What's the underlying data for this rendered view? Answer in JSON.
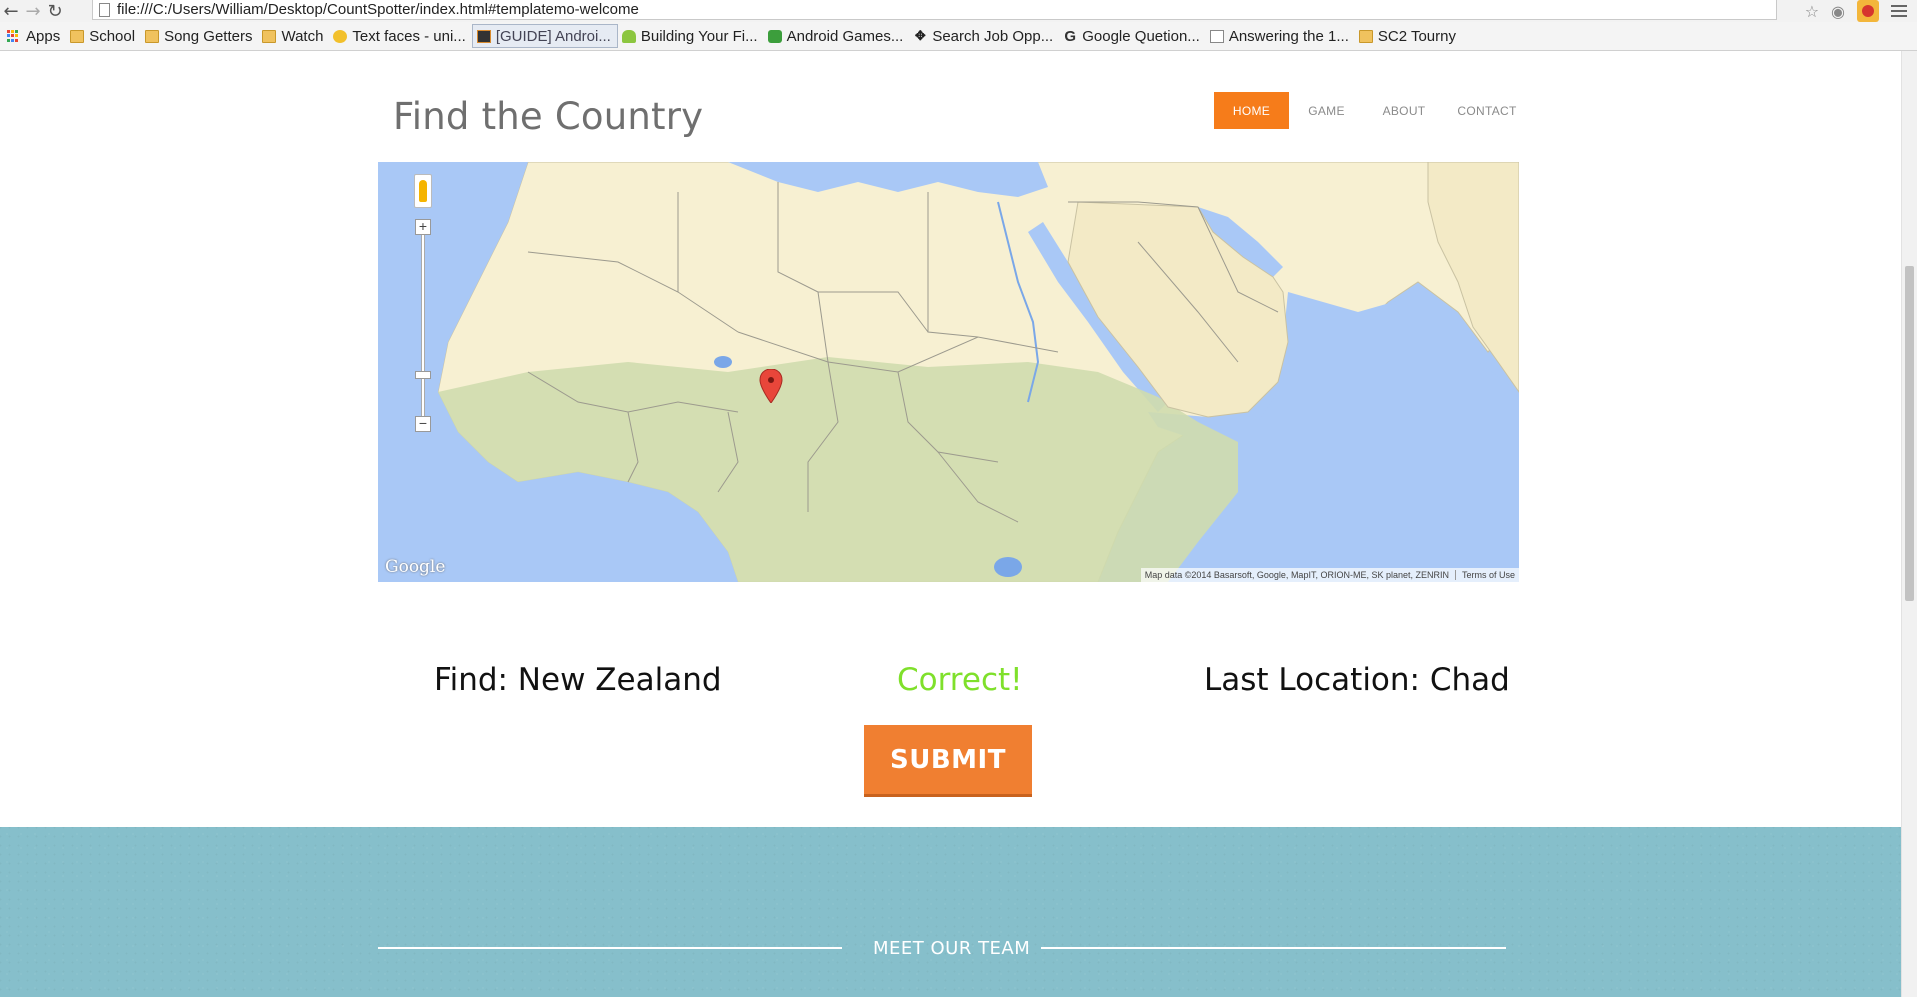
{
  "browser": {
    "url": "file:///C:/Users/William/Desktop/CountSpotter/index.html#templatemo-welcome",
    "bookmarks": [
      {
        "label": "Apps",
        "icon": "apps-grid-icon"
      },
      {
        "label": "School",
        "icon": "folder-icon"
      },
      {
        "label": "Song Getters",
        "icon": "folder-icon"
      },
      {
        "label": "Watch",
        "icon": "folder-icon"
      },
      {
        "label": "Text faces - uni...",
        "icon": "smiley-icon"
      },
      {
        "label": "[GUIDE] Androi...",
        "icon": "guide-site-icon"
      },
      {
        "label": "Building Your Fi...",
        "icon": "android-icon"
      },
      {
        "label": "Android Games...",
        "icon": "games-icon"
      },
      {
        "label": "Search Job Opp...",
        "icon": "job-site-icon"
      },
      {
        "label": "Google Quetion...",
        "icon": "google-g-icon"
      },
      {
        "label": "Answering the 1...",
        "icon": "page-icon"
      },
      {
        "label": "SC2 Tourny",
        "icon": "folder-icon"
      }
    ]
  },
  "site": {
    "title": "Find the Country",
    "nav": [
      "HOME",
      "GAME",
      "ABOUT",
      "CONTACT"
    ],
    "active_nav": "HOME"
  },
  "map": {
    "logo_text": "Google",
    "attribution": "Map data ©2014 Basarsoft, Google, MapIT, ORION-ME, SK planet, ZENRIN",
    "terms": "Terms of Use",
    "zoom_in": "+",
    "zoom_out": "−",
    "colors": {
      "water": "#a9c8f6",
      "desert": "#f7f0d2",
      "vegetation": "#cfdcae",
      "marker": "#e8463a"
    }
  },
  "game": {
    "find_text": "Find: New Zealand",
    "result_text": "Correct!",
    "last_location_text": "Last Location: Chad",
    "submit_label": "SUBMIT"
  },
  "team": {
    "heading": "MEET OUR TEAM"
  },
  "colors": {
    "accent": "#f67c1a",
    "correct": "#7fe02b",
    "team_bg": "#86bfcb"
  }
}
